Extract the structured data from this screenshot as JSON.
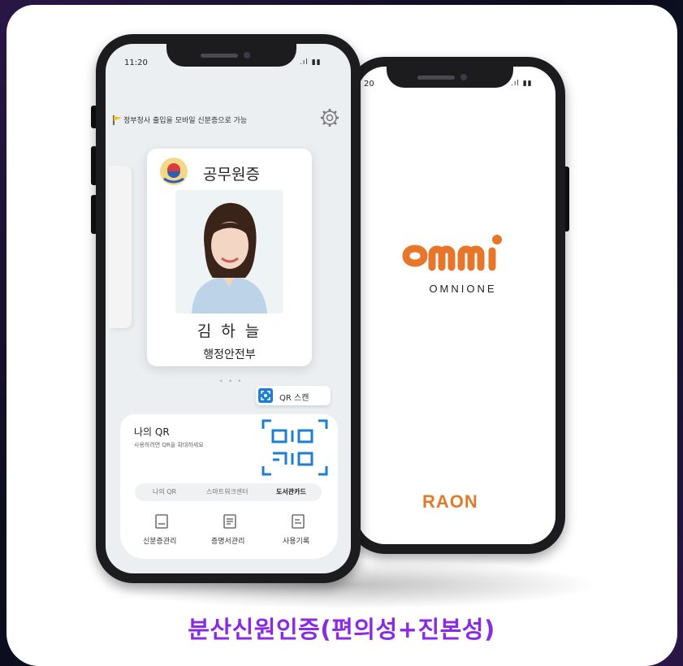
{
  "caption": "분산신원인증(편의성+진본성)",
  "back_phone": {
    "status_time": "20",
    "signal": ".ıl ▮▮",
    "brand_wordmark": "OMNIONE",
    "logo_text": "omni",
    "footer_brand": "RAON"
  },
  "front_phone": {
    "status_time": "11:20",
    "signal": ".ıl ▮▮",
    "notice": "정부청사 출입을 모바일 신분증으로 가능",
    "card": {
      "title": "공무원증",
      "name": "김 하 늘",
      "organization": "행정안전부"
    },
    "page_dots": "• • •",
    "qr_scan_label": "QR 스캔",
    "my_qr": {
      "title": "나의 QR",
      "subtitle": "사용하려면 QR을 확대하세요"
    },
    "segments": [
      {
        "label": "나의 QR",
        "active": false
      },
      {
        "label": "스마트워크센터",
        "active": false
      },
      {
        "label": "도서관카드",
        "active": true
      }
    ],
    "bottom_nav": [
      {
        "label": "신분증관리",
        "icon": "id-card-icon"
      },
      {
        "label": "증명서관리",
        "icon": "certificate-icon"
      },
      {
        "label": "사용기록",
        "icon": "history-icon"
      }
    ]
  },
  "colors": {
    "caption": "#8a2be2",
    "omni_orange": "#e8762a",
    "qr_scan_blue": "#1f7ed2",
    "phone_body": "#1c1c1e"
  }
}
